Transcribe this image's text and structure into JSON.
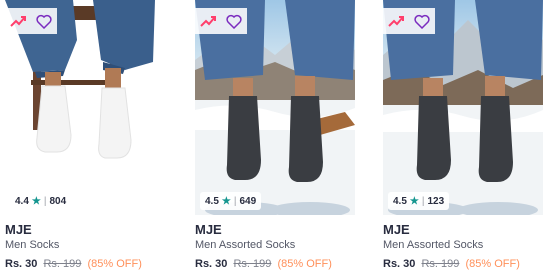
{
  "products": [
    {
      "brand": "MJE",
      "name": "Men Socks",
      "rating": "4.4",
      "rating_count": "804",
      "price": "Rs. 30",
      "mrp": "Rs. 199",
      "discount": "(85% OFF)",
      "badge_icons": [
        "trending-up-icon",
        "wishlist-heart-icon"
      ]
    },
    {
      "brand": "MJE",
      "name": "Men Assorted Socks",
      "rating": "4.5",
      "rating_count": "649",
      "price": "Rs. 30",
      "mrp": "Rs. 199",
      "discount": "(85% OFF)",
      "badge_icons": [
        "trending-up-icon",
        "wishlist-heart-icon"
      ]
    },
    {
      "brand": "MJE",
      "name": "Men Assorted Socks",
      "rating": "4.5",
      "rating_count": "123",
      "price": "Rs. 30",
      "mrp": "Rs. 199",
      "discount": "(85% OFF)",
      "badge_icons": [
        "trending-up-icon",
        "wishlist-heart-icon"
      ]
    }
  ],
  "colors": {
    "star": "#14958f",
    "discount": "#ff905a",
    "trend": "#ff3f6c",
    "heart": "#7b2cbf"
  },
  "rating_star_glyph": "★",
  "rating_separator": "|"
}
